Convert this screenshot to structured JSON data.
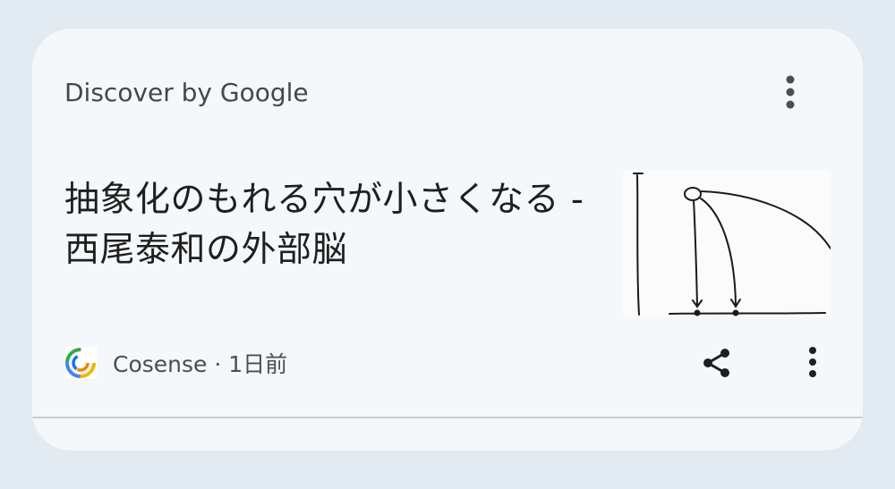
{
  "header": {
    "title": "Discover by Google",
    "menu_icon": "more-vert-icon"
  },
  "article": {
    "title": "抽象化のもれる穴が小さくなる - 西尾泰和の外部脳",
    "thumbnail_description_icon": "sketch-diagram-thumbnail"
  },
  "source": {
    "favicon_icon": "cosense-logo-icon",
    "label": "Cosense · 1日前"
  },
  "actions": {
    "share_icon": "share-icon",
    "more_icon": "more-vert-icon"
  },
  "colors": {
    "page_background": "#e1ebf1",
    "card_background": "#f4f8fb",
    "title_text": "#1f1f1f",
    "secondary_text": "#43484c",
    "icon": "#1f1f1f"
  }
}
